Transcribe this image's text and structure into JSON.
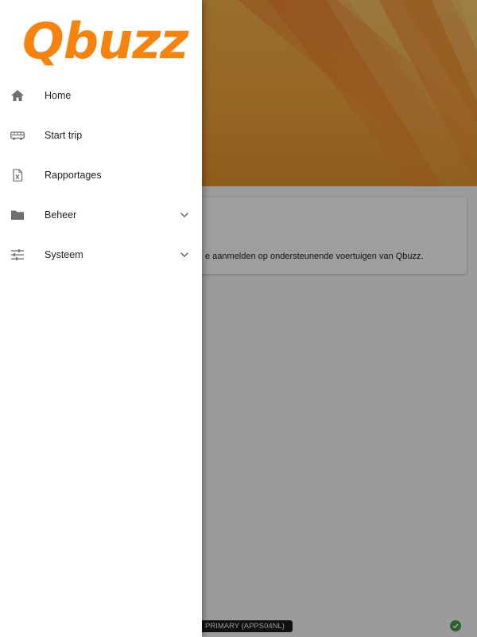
{
  "app": {
    "logo_text": "Qbuzz",
    "brand_color": "#f7830f"
  },
  "drawer": {
    "items": [
      {
        "label": "Home",
        "icon": "home-icon",
        "expandable": false
      },
      {
        "label": "Start trip",
        "icon": "bus-icon",
        "expandable": false
      },
      {
        "label": "Rapportages",
        "icon": "excel-report-icon",
        "expandable": false
      },
      {
        "label": "Beheer",
        "icon": "folder-icon",
        "expandable": true
      },
      {
        "label": "Systeem",
        "icon": "sliders-icon",
        "expandable": true
      }
    ]
  },
  "main": {
    "card_text": "e aanmelden op ondersteunende voertuigen van Qbuzz."
  },
  "footer": {
    "environment_badge": "PRIMARY (APPS04NL)",
    "status_icon": "check-circle-icon",
    "status_color": "#43a047"
  }
}
